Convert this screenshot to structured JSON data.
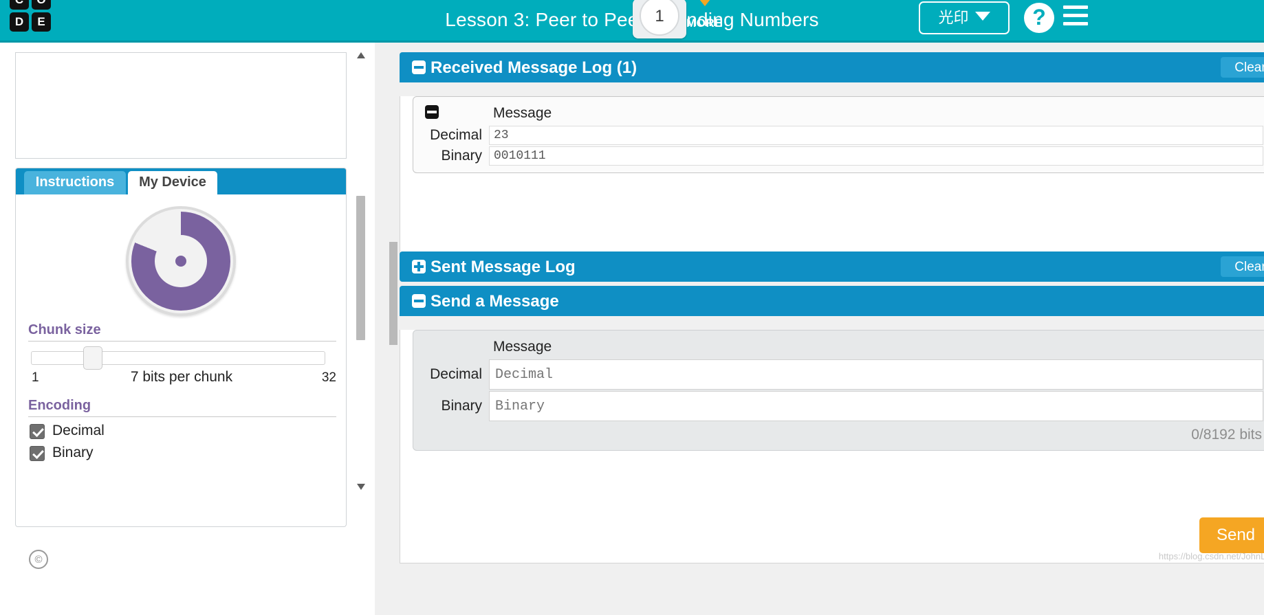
{
  "header": {
    "logo_letters": [
      "C",
      "O",
      "D",
      "E"
    ],
    "title": "Lesson 3: Peer to Peer - Sending Numbers",
    "level_number": "1",
    "more_label": "MORE",
    "language_label": "光印",
    "caret_icon": "chevron-down-icon",
    "help_icon": "?",
    "menu_icon": "hamburger-icon"
  },
  "left_panel": {
    "tabs": [
      {
        "label": "Instructions",
        "active": false
      },
      {
        "label": "My Device",
        "active": true
      }
    ],
    "dial": {
      "icon": "rotary-dial-icon",
      "color": "#7a629f"
    },
    "chunk_size": {
      "title": "Chunk size",
      "min": "1",
      "max": "32",
      "value_text": "7 bits per chunk"
    },
    "encoding": {
      "title": "Encoding",
      "options": [
        {
          "label": "Decimal",
          "checked": true
        },
        {
          "label": "Binary",
          "checked": true
        }
      ]
    },
    "copyright_badge": "©"
  },
  "received_log": {
    "title": "Received Message Log (1)",
    "toggle_state": "collapse",
    "clear_label": "Clear",
    "column_header": "Message",
    "rows": [
      {
        "label": "Decimal",
        "value": "23"
      },
      {
        "label": "Binary",
        "value": "0010111"
      }
    ]
  },
  "sent_log": {
    "title": "Sent Message Log",
    "toggle_state": "expand",
    "clear_label": "Clear"
  },
  "send_message": {
    "title": "Send a Message",
    "toggle_state": "collapse",
    "column_header": "Message",
    "fields": [
      {
        "label": "Decimal",
        "placeholder": "Decimal",
        "value": ""
      },
      {
        "label": "Binary",
        "placeholder": "Binary",
        "value": ""
      }
    ],
    "bits_counter": "0/8192 bits",
    "send_label": "Send"
  },
  "watermark": "https://blog.csdn.net/JohnLeao",
  "colors": {
    "header_teal": "#00adbc",
    "panel_blue": "#0f8fc4",
    "accent_purple": "#7a629f",
    "send_orange": "#f5a623"
  }
}
